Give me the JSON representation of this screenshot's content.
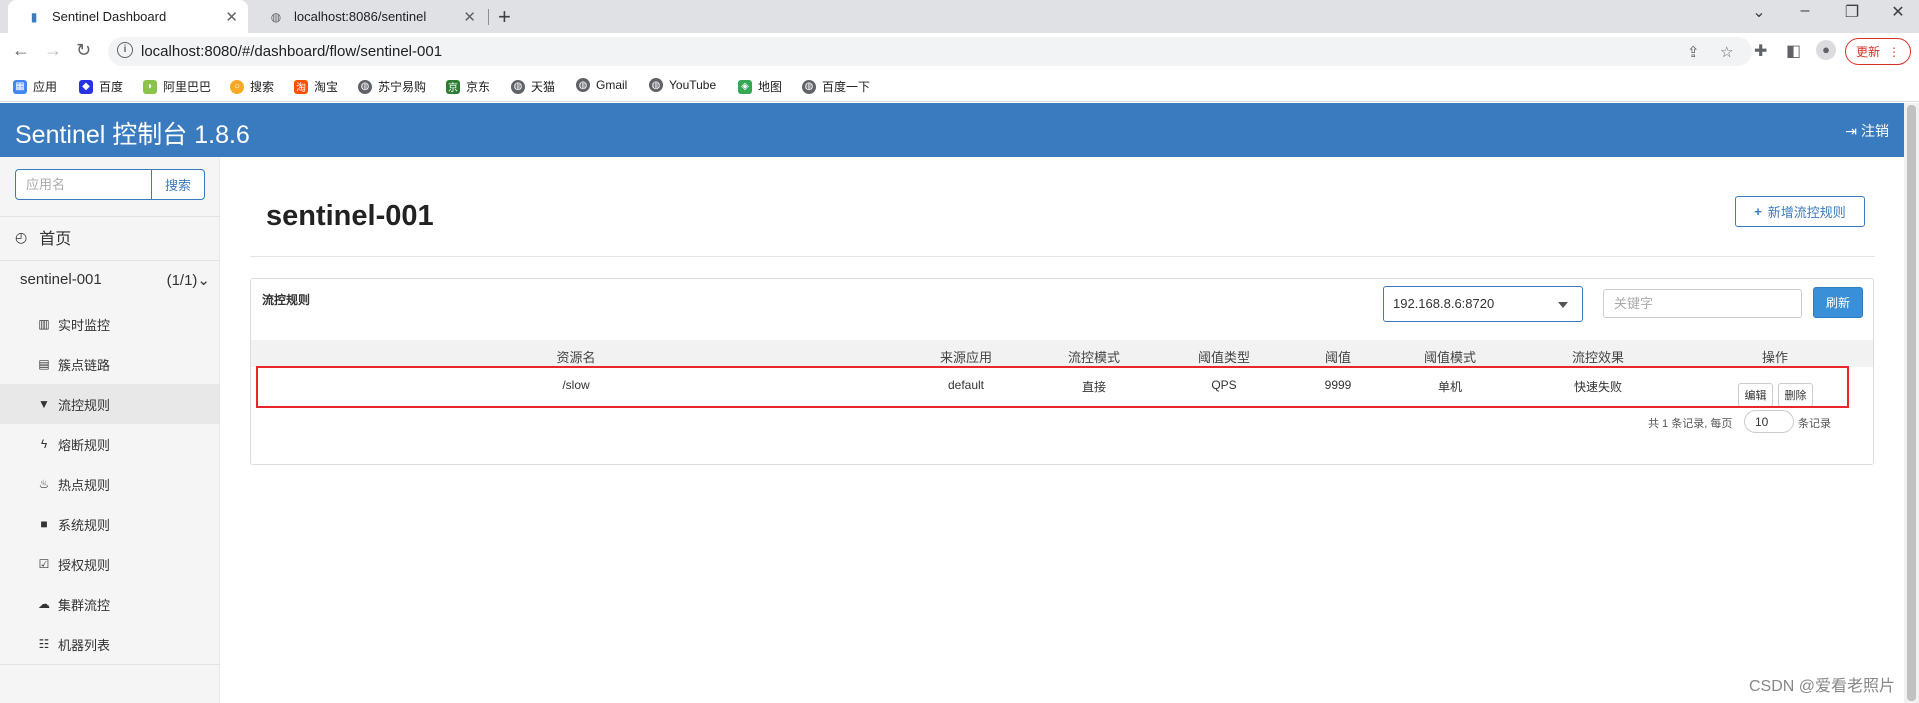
{
  "browser": {
    "tabs": [
      {
        "title": "Sentinel Dashboard",
        "active": true
      },
      {
        "title": "localhost:8086/sentinel",
        "active": false
      }
    ],
    "url": "localhost:8080/#/dashboard/flow/sentinel-001",
    "update_label": "更新",
    "bookmarks": [
      {
        "label": "应用",
        "icon": "apps-grid-icon",
        "color": "#4285f4"
      },
      {
        "label": "百度",
        "icon": "baidu-paw-icon",
        "color": "#2932e1"
      },
      {
        "label": "阿里巴巴",
        "icon": "alibaba-icon",
        "color": "#8bc34a"
      },
      {
        "label": "搜索",
        "icon": "search-o-icon",
        "color": "#f9a825"
      },
      {
        "label": "淘宝",
        "icon": "taobao-icon",
        "color": "#ff5000"
      },
      {
        "label": "苏宁易购",
        "icon": "globe-icon",
        "color": "#5f6368"
      },
      {
        "label": "京东",
        "icon": "jd-icon",
        "color": "#2e7d32"
      },
      {
        "label": "天猫",
        "icon": "globe-icon",
        "color": "#5f6368"
      },
      {
        "label": "Gmail",
        "icon": "globe-icon",
        "color": "#5f6368"
      },
      {
        "label": "YouTube",
        "icon": "globe-icon",
        "color": "#5f6368"
      },
      {
        "label": "地图",
        "icon": "maps-icon",
        "color": "#34a853"
      },
      {
        "label": "百度一下",
        "icon": "globe-icon",
        "color": "#5f6368"
      }
    ]
  },
  "app": {
    "brand": "Sentinel 控制台 1.8.6",
    "logout": "注销",
    "accent": "#3a7bbf"
  },
  "sidebar": {
    "search_placeholder": "应用名",
    "search_button": "搜索",
    "home": "首页",
    "app_name": "sentinel-001",
    "app_count": "(1/1)",
    "menu": [
      {
        "label": "实时监控",
        "icon": "bar-chart-icon",
        "active": false
      },
      {
        "label": "簇点链路",
        "icon": "list-icon",
        "active": false
      },
      {
        "label": "流控规则",
        "icon": "filter-icon",
        "active": true
      },
      {
        "label": "熔断规则",
        "icon": "flash-icon",
        "active": false
      },
      {
        "label": "热点规则",
        "icon": "fire-icon",
        "active": false
      },
      {
        "label": "系统规则",
        "icon": "lock-icon",
        "active": false
      },
      {
        "label": "授权规则",
        "icon": "check-square-icon",
        "active": false
      },
      {
        "label": "集群流控",
        "icon": "cloud-icon",
        "active": false
      },
      {
        "label": "机器列表",
        "icon": "th-list-icon",
        "active": false
      }
    ]
  },
  "main": {
    "title": "sentinel-001",
    "add_button": "新增流控规则",
    "panel_title": "流控规则",
    "machine": "192.168.8.6:8720",
    "keyword_placeholder": "关键字",
    "refresh": "刷新",
    "columns": [
      "资源名",
      "来源应用",
      "流控模式",
      "阈值类型",
      "阈值",
      "阈值模式",
      "流控效果",
      "操作"
    ],
    "rows": [
      {
        "resource": "/slow",
        "origin": "default",
        "mode": "直接",
        "grade": "QPS",
        "count": "9999",
        "cluster": "单机",
        "effect": "快速失败",
        "edit": "编辑",
        "delete": "删除"
      }
    ],
    "pager": {
      "prefix": "共 1 条记录, 每页",
      "page_size": "10",
      "suffix": "条记录"
    }
  },
  "watermark": "CSDN @爱看老照片"
}
